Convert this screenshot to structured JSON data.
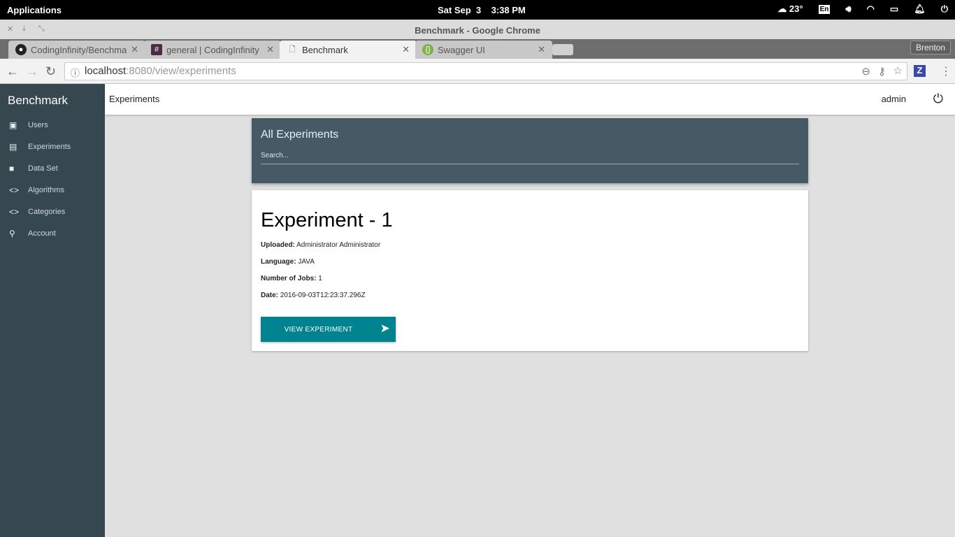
{
  "os": {
    "applications": "Applications",
    "clock": "Sat Sep  3    3:38 PM",
    "weather": "23°",
    "keyboard": "En",
    "icons": [
      "weather-cloud-icon",
      "keyboard-layout-icon",
      "volume-icon",
      "wifi-icon",
      "battery-icon",
      "notification-bell-icon",
      "power-icon"
    ]
  },
  "window": {
    "title": "Benchmark - Google Chrome",
    "profile": "Brenton"
  },
  "tabs": [
    {
      "label": "CodingInfinity/Benchmark",
      "icon": "github-icon"
    },
    {
      "label": "general | CodingInfinity Slack",
      "icon": "slack-hash-icon"
    },
    {
      "label": "Benchmark",
      "icon": "page-icon",
      "active": true
    },
    {
      "label": "Swagger UI",
      "icon": "swagger-icon"
    }
  ],
  "address": {
    "host": "localhost",
    "rest": ":8080/view/experiments"
  },
  "sidebar": {
    "brand": "Benchmark",
    "items": [
      {
        "label": "Users",
        "icon": "users-card-icon"
      },
      {
        "label": "Experiments",
        "icon": "clipboard-icon"
      },
      {
        "label": "Data Set",
        "icon": "folder-icon"
      },
      {
        "label": "Algorithms",
        "icon": "code-icon"
      },
      {
        "label": "Categories",
        "icon": "code-icon"
      },
      {
        "label": "Account",
        "icon": "person-icon"
      }
    ]
  },
  "header": {
    "title": "Experiments",
    "user": "admin"
  },
  "search": {
    "title": "All Experiments",
    "placeholder": "Search..."
  },
  "experiment": {
    "title": "Experiment - 1",
    "fields": [
      {
        "label": "Uploaded:",
        "value": "Administrator Administrator"
      },
      {
        "label": "Language:",
        "value": "JAVA"
      },
      {
        "label": "Number of Jobs:",
        "value": "1"
      },
      {
        "label": "Date:",
        "value": "2016-09-03T12:23:37.296Z"
      }
    ],
    "button": "VIEW EXPERIMENT"
  },
  "colors": {
    "sidebar": "#37474f",
    "search_header": "#455a64",
    "button": "#00838f"
  }
}
